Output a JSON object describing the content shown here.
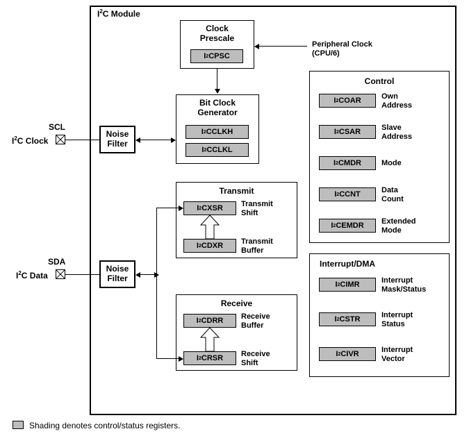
{
  "module": {
    "title_html": "I<sup>2</sup>C Module"
  },
  "external": {
    "scl": "SCL",
    "scl_desc_html": "I<sup>2</sup>C Clock",
    "sda": "SDA",
    "sda_desc_html": "I<sup>2</sup>C Data",
    "peripheral_clock": "Peripheral Clock\n(CPU/6)"
  },
  "noise_filter": "Noise\nFilter",
  "blocks": {
    "clock_prescale": {
      "title": "Clock\nPrescale",
      "reg_html": "I<sup>2</sup>CPSC"
    },
    "bit_clock_gen": {
      "title": "Bit Clock\nGenerator",
      "reg_hi_html": "I<sup>2</sup>CCLKH",
      "reg_lo_html": "I<sup>2</sup>CCLKL"
    },
    "transmit": {
      "title": "Transmit",
      "xsr_html": "I<sup>2</sup>CXSR",
      "xsr_label": "Transmit\nShift",
      "dxr_html": "I<sup>2</sup>CDXR",
      "dxr_label": "Transmit\nBuffer"
    },
    "receive": {
      "title": "Receive",
      "drr_html": "I<sup>2</sup>CDRR",
      "drr_label": "Receive\nBuffer",
      "rsr_html": "I<sup>2</sup>CRSR",
      "rsr_label": "Receive\nShift"
    },
    "control": {
      "title": "Control",
      "oar_html": "I<sup>2</sup>COAR",
      "oar_label": "Own\nAddress",
      "sar_html": "I<sup>2</sup>CSAR",
      "sar_label": "Slave\nAddress",
      "mdr_html": "I<sup>2</sup>CMDR",
      "mdr_label": "Mode",
      "cnt_html": "I<sup>2</sup>CCNT",
      "cnt_label": "Data\nCount",
      "emdr_html": "I<sup>2</sup>CEMDR",
      "emdr_label": "Extended\nMode"
    },
    "interrupt_dma": {
      "title": "Interrupt/DMA",
      "imr_html": "I<sup>2</sup>CIMR",
      "imr_label": "Interrupt\nMask/Status",
      "str_html": "I<sup>2</sup>CSTR",
      "str_label": "Interrupt\nStatus",
      "ivr_html": "I<sup>2</sup>CIVR",
      "ivr_label": "Interrupt\nVector"
    }
  },
  "legend": "Shading denotes control/status registers."
}
